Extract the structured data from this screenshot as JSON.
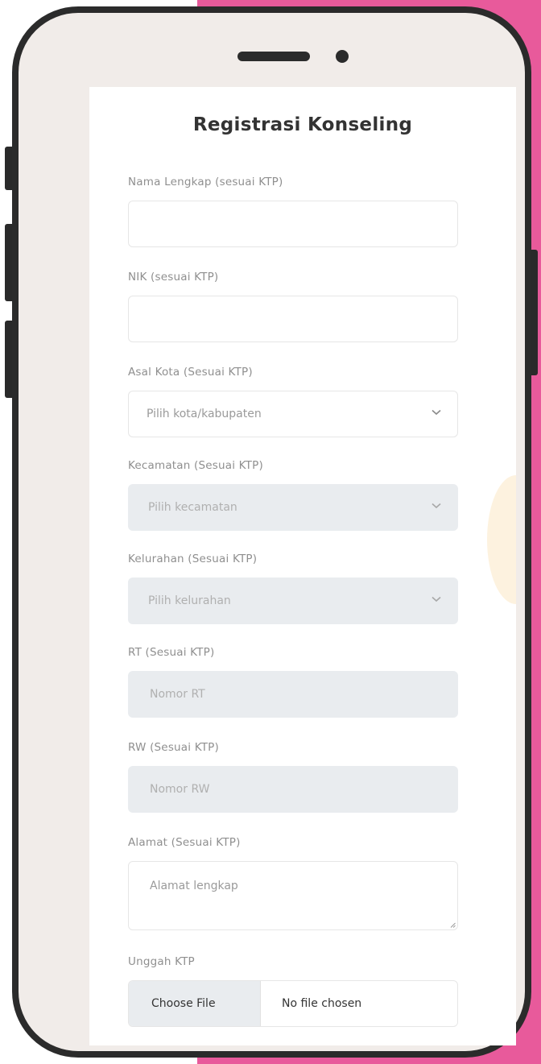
{
  "form": {
    "title": "Registrasi Konseling",
    "fields": [
      {
        "label": "Nama Lengkap (sesuai KTP)",
        "value": ""
      },
      {
        "label": "NIK (sesuai KTP)",
        "value": ""
      },
      {
        "label": "Asal Kota (Sesuai KTP)",
        "placeholder": "Pilih kota/kabupaten"
      },
      {
        "label": "Kecamatan (Sesuai KTP)",
        "placeholder": "Pilih kecamatan"
      },
      {
        "label": "Kelurahan (Sesuai KTP)",
        "placeholder": "Pilih kelurahan"
      },
      {
        "label": "RT (Sesuai KTP)",
        "placeholder": "Nomor RT"
      },
      {
        "label": "RW (Sesuai KTP)",
        "placeholder": "Nomor RW"
      },
      {
        "label": "Alamat (Sesuai KTP)",
        "placeholder": "Alamat lengkap"
      },
      {
        "label": "Unggah KTP",
        "button_label": "Choose File",
        "status": "No file chosen"
      }
    ]
  },
  "colors": {
    "background_accent": "#e85a9b",
    "phone_frame": "#2b2b2b",
    "phone_bezel": "#f1ece9",
    "disabled_field": "#e9ecef"
  },
  "icons": {
    "select_arrow": "chevron-down-icon"
  }
}
